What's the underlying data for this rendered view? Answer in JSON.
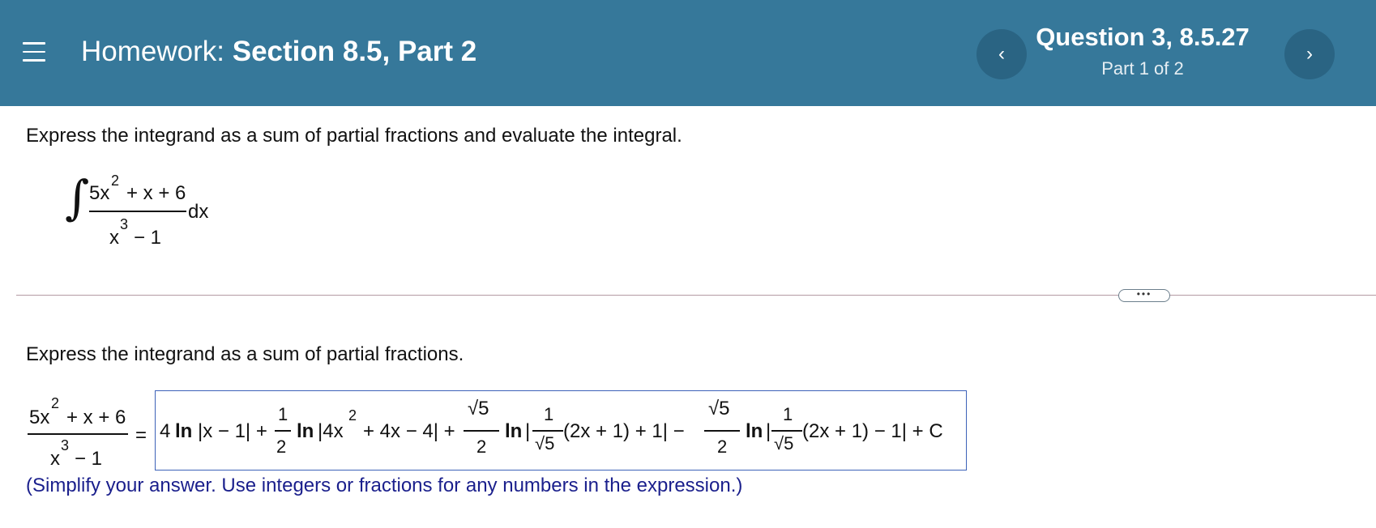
{
  "header": {
    "menu_icon": "hamburger-menu-icon",
    "title_prefix": "Homework:",
    "title_section": "Section 8.5, Part 2",
    "prev_symbol": "‹",
    "next_symbol": "›",
    "question_title": "Question 3, 8.5.27",
    "question_part": "Part 1 of 2"
  },
  "problem": {
    "instruction": "Express the integrand as a sum of partial fractions and evaluate the integral.",
    "integral_sign": "∫",
    "numerator_base": "5x",
    "numerator_exp": "2",
    "numerator_rest": "+ x + 6",
    "denominator_base": "x",
    "denominator_exp": "3",
    "denominator_rest": "− 1",
    "differential": "dx"
  },
  "more_button": "•••",
  "step": {
    "instruction": "Express the integrand as a sum of partial fractions.",
    "equals": "=",
    "answer": {
      "t1": "4",
      "ln": "ln",
      "t1_arg": "|x − 1| +",
      "frac1_num": "1",
      "frac1_den": "2",
      "t2_arg_a": "|4x",
      "t2_exp": "2",
      "t2_arg_b": "+ 4x − 4| +",
      "sqrt5": "√5",
      "two": "2",
      "one": "1",
      "bar": "|",
      "t3_tail": "(2x + 1) + 1| −",
      "t4_tail": "(2x + 1) − 1| + C"
    },
    "hint": "(Simplify your answer. Use integers or fractions for any numbers in the expression.)"
  }
}
